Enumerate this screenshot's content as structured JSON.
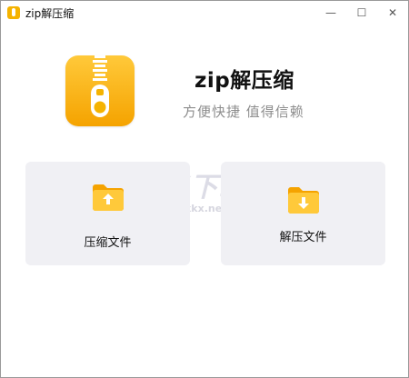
{
  "window": {
    "title": "zip解压缩"
  },
  "controls": {
    "minimize": "—",
    "maximize": "☐",
    "close": "✕"
  },
  "header": {
    "app_name": "zip解压缩",
    "tagline": "方便快捷 值得信赖"
  },
  "actions": {
    "compress_label": "压缩文件",
    "extract_label": "解压文件"
  },
  "watermark": {
    "logo_text": "KK下载",
    "url": "www.kkx.net"
  },
  "colors": {
    "accent": "#f5b300",
    "card_bg": "#f0f0f4",
    "tagline": "#8e8e8e"
  }
}
